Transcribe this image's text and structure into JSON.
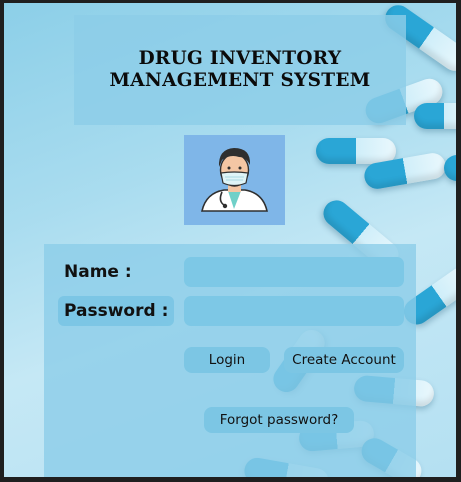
{
  "header": {
    "title_line1": "DRUG INVENTORY",
    "title_line2": "MANAGEMENT SYSTEM"
  },
  "login": {
    "name_label": "Name :",
    "password_label": "Password :",
    "name_value": "",
    "password_value": "",
    "login_label": "Login",
    "create_account_label": "Create Account",
    "forgot_password_label": "Forgot password?"
  },
  "avatar": {
    "icon": "doctor-avatar-icon"
  },
  "colors": {
    "panel": "#8ccde8",
    "input": "#7dc8e6",
    "button": "#7cc6e4",
    "capsule": "#2aa6d6"
  }
}
